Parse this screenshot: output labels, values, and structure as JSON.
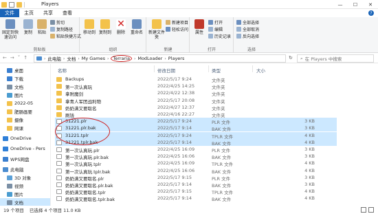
{
  "window": {
    "title": "Players",
    "controls": [
      "—",
      "☐",
      "✕"
    ]
  },
  "tabs": [
    "文件",
    "主页",
    "共享",
    "查看"
  ],
  "ribbon": {
    "groups": [
      {
        "label": "剪贴板",
        "big": [
          "固定到快速访问",
          "复制",
          "粘贴"
        ],
        "small": [
          "剪切",
          "复制路径",
          "粘贴快捷方式"
        ]
      },
      {
        "label": "组织",
        "big": [
          "移动到",
          "复制到",
          "删除",
          "重命名"
        ]
      },
      {
        "label": "新建",
        "big": [
          "新建文件夹"
        ],
        "small": [
          "新建项目",
          "轻松访问"
        ]
      },
      {
        "label": "打开",
        "big": [
          "属性"
        ],
        "small": [
          "打开",
          "编辑",
          "历史记录"
        ]
      },
      {
        "label": "选择",
        "small": [
          "全部选择",
          "全部取消",
          "反向选择"
        ]
      }
    ]
  },
  "address": {
    "nav": [
      "←",
      "→",
      "˅",
      "↑"
    ],
    "crumbs": [
      "此电脑",
      "文档",
      "My Games",
      "Terraria",
      "ModLoader",
      "Players"
    ],
    "search_placeholder": "在 Players 中搜索"
  },
  "navpane": [
    {
      "label": "桌面",
      "color": "#3a7fd0"
    },
    {
      "label": "下载",
      "color": "#3a7fd0"
    },
    {
      "label": "文档",
      "color": "#7a8fa5"
    },
    {
      "label": "图片",
      "color": "#4a9cd0"
    },
    {
      "label": "2022-05",
      "color": "#f3c24b"
    },
    {
      "label": "肥肠画要",
      "color": "#f3c24b"
    },
    {
      "label": "摄像",
      "color": "#f3c24b"
    },
    {
      "label": "网课",
      "color": "#f3c24b"
    },
    {
      "label": "OneDrive",
      "color": "#2f7fd8"
    },
    {
      "label": "OneDrive - Pers",
      "color": "#2f7fd8"
    },
    {
      "label": "WPS网盘",
      "color": "#3a7fd0"
    },
    {
      "label": "此电脑",
      "color": "#4a8cd0"
    },
    {
      "label": "3D 对象",
      "color": "#5aa0d8"
    },
    {
      "label": "视频",
      "color": "#7a8fa5"
    },
    {
      "label": "图片",
      "color": "#4a9cd0"
    },
    {
      "label": "文档",
      "color": "#7a8fa5"
    }
  ],
  "columns": [
    "名称",
    "修改日期",
    "类型",
    "大小"
  ],
  "files": [
    {
      "name": "Backups",
      "date": "2022/5/17 9:24",
      "type": "文件夹",
      "size": "",
      "kind": "folder",
      "selected": false
    },
    {
      "name": "第一次认真玩",
      "date": "2022/4/25 14:25",
      "type": "文件夹",
      "size": "",
      "kind": "folder",
      "selected": false
    },
    {
      "name": "拿附魔剑",
      "date": "2022/4/22 12:38",
      "type": "文件夹",
      "size": "",
      "kind": "folder",
      "selected": false
    },
    {
      "name": "拿青人军团战利物",
      "date": "2022/5/17 20:08",
      "type": "文件夹",
      "size": "",
      "kind": "folder",
      "selected": false
    },
    {
      "name": "奶奶满又要取名",
      "date": "2022/4/27 12:37",
      "type": "文件夹",
      "size": "",
      "kind": "folder",
      "selected": false
    },
    {
      "name": "刷钱",
      "date": "2022/4/16 22:27",
      "type": "文件夹",
      "size": "",
      "kind": "folder",
      "selected": false
    },
    {
      "name": "31221.plr",
      "date": "2022/5/17 9:24",
      "type": "PLR 文件",
      "size": "3 KB",
      "kind": "file",
      "selected": true
    },
    {
      "name": "31221.plr.bak",
      "date": "2022/5/17 9:14",
      "type": "BAK 文件",
      "size": "3 KB",
      "kind": "file",
      "selected": true
    },
    {
      "name": "31221.tplr",
      "date": "2022/5/17 9:24",
      "type": "TPLR 文件",
      "size": "4 KB",
      "kind": "file",
      "selected": true
    },
    {
      "name": "31221.tplr.bak",
      "date": "2022/5/17 9:14",
      "type": "BAK 文件",
      "size": "4 KB",
      "kind": "file",
      "selected": true
    },
    {
      "name": "第一次认真玩.plr",
      "date": "2022/4/25 16:09",
      "type": "PLR 文件",
      "size": "3 KB",
      "kind": "file",
      "selected": false
    },
    {
      "name": "第一次认真玩.plr.bak",
      "date": "2022/4/25 16:06",
      "type": "BAK 文件",
      "size": "3 KB",
      "kind": "file",
      "selected": false
    },
    {
      "name": "第一次认真玩.tplr",
      "date": "2022/4/25 16:09",
      "type": "TPLR 文件",
      "size": "4 KB",
      "kind": "file",
      "selected": false
    },
    {
      "name": "第一次认真玩.tplr.bak",
      "date": "2022/4/25 16:06",
      "type": "BAK 文件",
      "size": "4 KB",
      "kind": "file",
      "selected": false
    },
    {
      "name": "奶奶满又要取名.plr",
      "date": "2022/5/17 9:15",
      "type": "PLR 文件",
      "size": "3 KB",
      "kind": "file",
      "selected": false
    },
    {
      "name": "奶奶满又要取名.plr.bak",
      "date": "2022/5/17 9:14",
      "type": "BAK 文件",
      "size": "3 KB",
      "kind": "file",
      "selected": false
    },
    {
      "name": "奶奶满又要取名.tplr",
      "date": "2022/5/17 9:15",
      "type": "TPLR 文件",
      "size": "4 KB",
      "kind": "file",
      "selected": false
    },
    {
      "name": "奶奶满又要取名.tplr.bak",
      "date": "2022/5/17 9:14",
      "type": "BAK 文件",
      "size": "4 KB",
      "kind": "file",
      "selected": false
    }
  ],
  "status": {
    "count": "19 个项目",
    "selection": "已选择 4 个项目 11.0 KB"
  },
  "colors": {
    "accent": "#1a64b8",
    "selection": "#cce8ff",
    "annotation": "#d02020"
  }
}
